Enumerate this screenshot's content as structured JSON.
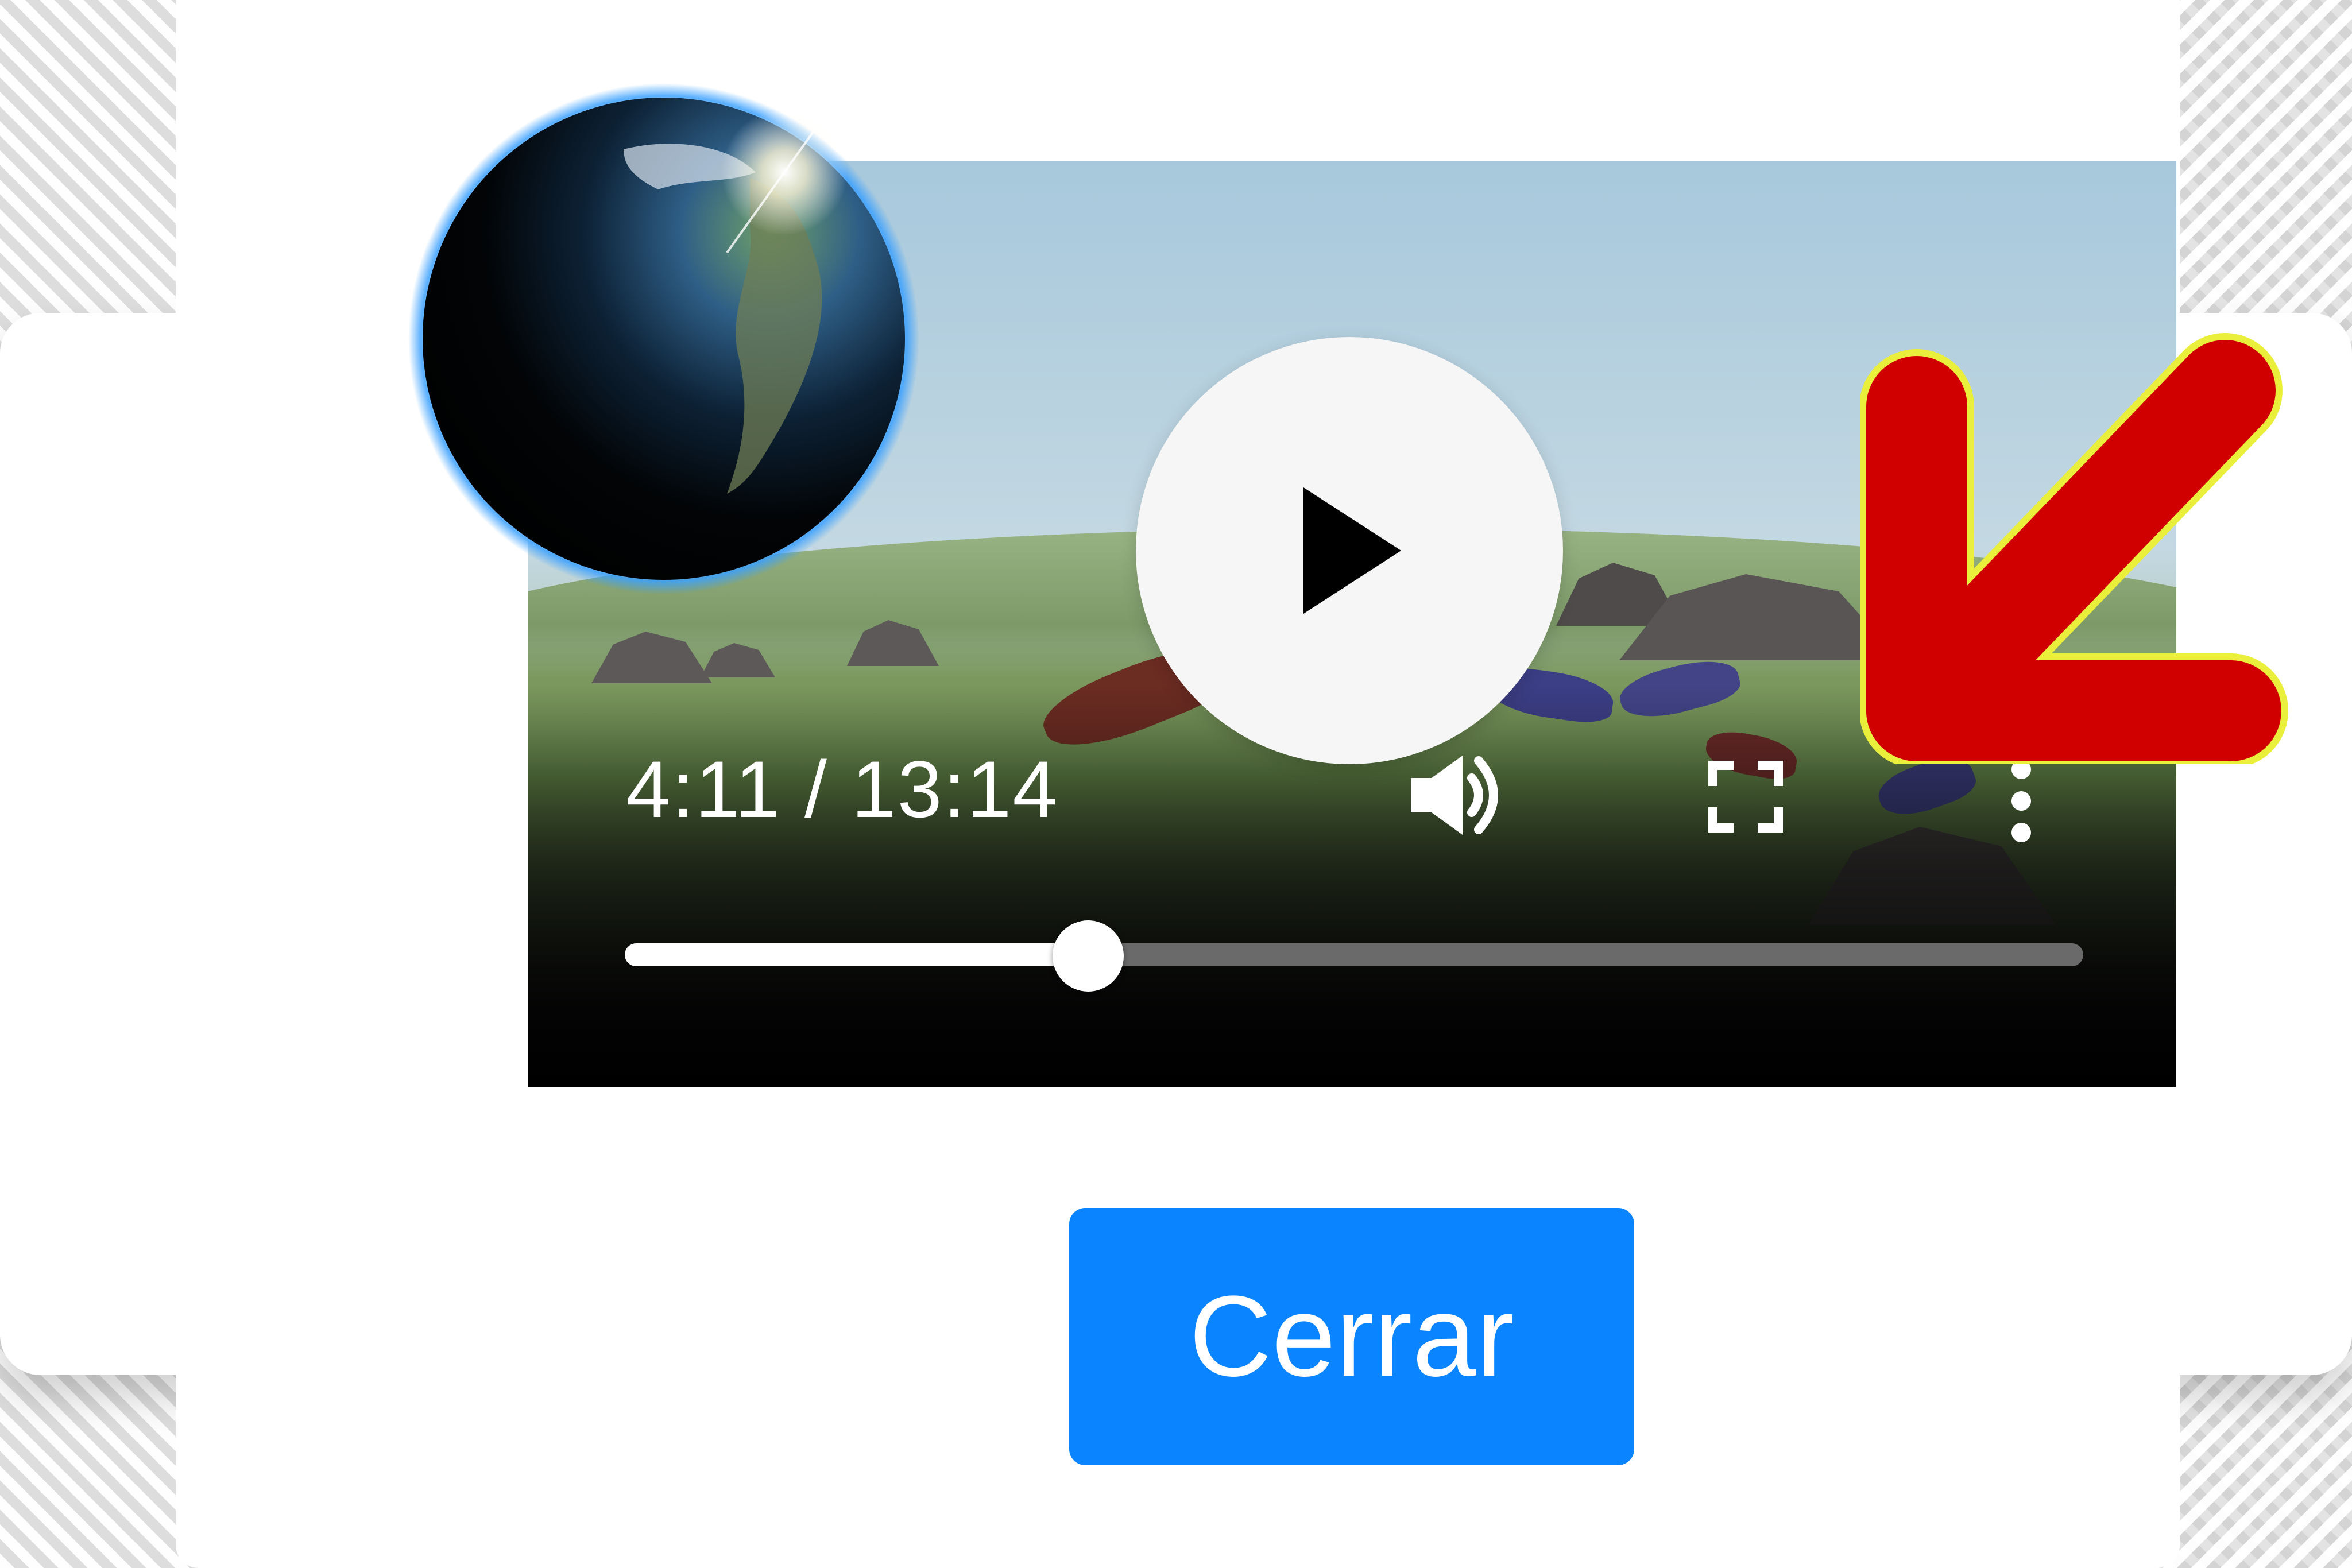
{
  "player": {
    "time_display": "4:11 / 13:14",
    "progress_fraction": 0.3177
  },
  "dialog": {
    "close_label": "Cerrar"
  },
  "icons": {
    "play": "play-icon",
    "volume": "volume-icon",
    "fullscreen": "fullscreen-icon",
    "more": "more-options-icon",
    "logo": "globe-logo-icon",
    "annotation": "red-arrow-icon"
  },
  "colors": {
    "button_blue": "#0a84ff",
    "arrow_red": "#d10000",
    "arrow_outline": "#e9ef3a"
  }
}
